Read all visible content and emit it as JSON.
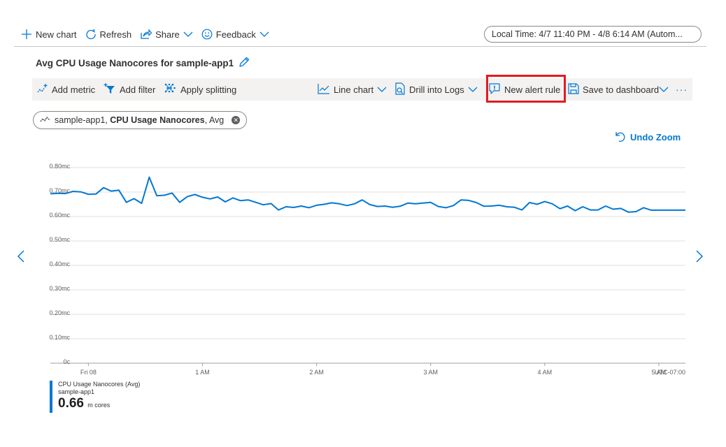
{
  "topbar": {
    "new_chart": "New chart",
    "refresh": "Refresh",
    "share": "Share",
    "feedback": "Feedback",
    "time_range": "Local Time: 4/7 11:40 PM - 4/8 6:14 AM (Autom..."
  },
  "chart_title": "Avg CPU Usage Nanocores for sample-app1",
  "toolbar": {
    "add_metric": "Add metric",
    "add_filter": "Add filter",
    "apply_splitting": "Apply splitting",
    "line_chart": "Line chart",
    "drill_into_logs": "Drill into Logs",
    "new_alert_rule": "New alert rule",
    "save_to_dashboard": "Save to dashboard",
    "more": "···"
  },
  "metric_pill": {
    "resource": "sample-app1, ",
    "metric": "CPU Usage Nanocores",
    "aggregation": ", Avg"
  },
  "undo_zoom": "Undo Zoom",
  "legend": {
    "metric_label": "CPU Usage Nanocores (Avg)",
    "resource": "sample-app1",
    "value": "0.66",
    "unit": "m cores"
  },
  "colors": {
    "accent": "#0078d4",
    "highlight": "#e11b22",
    "grid": "#e1dfdd"
  },
  "chart_data": {
    "type": "line",
    "title": "Avg CPU Usage Nanocores for sample-app1",
    "ylabel": "",
    "xlabel": "",
    "ylim": [
      0,
      0.8
    ],
    "y_ticks": [
      {
        "value": 0.8,
        "label": "0.80mc"
      },
      {
        "value": 0.7,
        "label": "0.70mc"
      },
      {
        "value": 0.6,
        "label": "0.60mc"
      },
      {
        "value": 0.5,
        "label": "0.50mc"
      },
      {
        "value": 0.4,
        "label": "0.40mc"
      },
      {
        "value": 0.3,
        "label": "0.30mc"
      },
      {
        "value": 0.2,
        "label": "0.20mc"
      },
      {
        "value": 0.1,
        "label": "0.10mc"
      },
      {
        "value": 0,
        "label": "0c"
      }
    ],
    "x_range_minutes": [
      -20,
      314
    ],
    "x_ticks": [
      {
        "minute": 0,
        "label": "Fri 08"
      },
      {
        "minute": 60,
        "label": "1 AM"
      },
      {
        "minute": 120,
        "label": "2 AM"
      },
      {
        "minute": 180,
        "label": "3 AM"
      },
      {
        "minute": 240,
        "label": "4 AM"
      },
      {
        "minute": 300,
        "label": "5 AM"
      }
    ],
    "timezone_label": "UTC-07:00",
    "grid": true,
    "series": [
      {
        "name": "CPU Usage Nanocores (Avg) sample-app1",
        "color": "#0078d4",
        "x_minutes": [
          -20,
          -16,
          -12,
          -8,
          -4,
          0,
          4,
          8,
          12,
          16,
          20,
          24,
          28,
          32,
          36,
          40,
          44,
          48,
          52,
          56,
          60,
          64,
          68,
          72,
          76,
          80,
          84,
          88,
          92,
          96,
          100,
          104,
          108,
          112,
          116,
          120,
          124,
          128,
          132,
          136,
          140,
          144,
          148,
          152,
          156,
          160,
          164,
          168,
          172,
          176,
          180,
          184,
          188,
          192,
          196,
          200,
          204,
          208,
          212,
          216,
          220,
          224,
          228,
          232,
          236,
          240,
          244,
          248,
          252,
          256,
          260,
          264,
          268,
          272,
          276,
          280,
          284,
          288,
          292,
          296,
          300,
          304,
          308,
          312,
          314
        ],
        "values": [
          0.693,
          0.695,
          0.694,
          0.703,
          0.701,
          0.691,
          0.692,
          0.718,
          0.704,
          0.708,
          0.658,
          0.673,
          0.654,
          0.761,
          0.685,
          0.687,
          0.696,
          0.658,
          0.681,
          0.69,
          0.679,
          0.672,
          0.68,
          0.66,
          0.676,
          0.665,
          0.668,
          0.658,
          0.648,
          0.653,
          0.627,
          0.64,
          0.637,
          0.643,
          0.636,
          0.646,
          0.65,
          0.656,
          0.652,
          0.645,
          0.652,
          0.668,
          0.649,
          0.641,
          0.643,
          0.638,
          0.642,
          0.655,
          0.652,
          0.655,
          0.658,
          0.641,
          0.636,
          0.645,
          0.668,
          0.666,
          0.657,
          0.642,
          0.643,
          0.646,
          0.64,
          0.638,
          0.627,
          0.657,
          0.65,
          0.661,
          0.652,
          0.632,
          0.643,
          0.624,
          0.64,
          0.627,
          0.627,
          0.643,
          0.63,
          0.633,
          0.618,
          0.62,
          0.636,
          0.626,
          0.626,
          0.626,
          0.626,
          0.626,
          0.626
        ]
      }
    ]
  }
}
